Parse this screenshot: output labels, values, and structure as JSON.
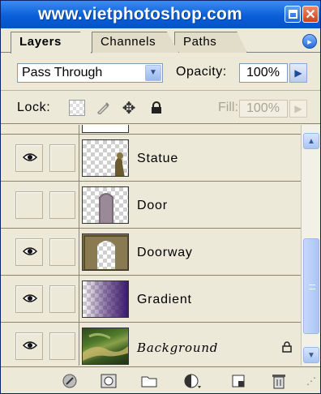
{
  "window": {
    "title": "www.vietphotoshop.com"
  },
  "tabs": [
    {
      "label": "Layers",
      "active": true
    },
    {
      "label": "Channels",
      "active": false
    },
    {
      "label": "Paths",
      "active": false
    }
  ],
  "blend": {
    "mode": "Pass Through",
    "opacity_label": "Opacity:",
    "opacity_value": "100%"
  },
  "lock": {
    "label": "Lock:",
    "fill_label": "Fill:",
    "fill_value": "100%"
  },
  "layers": [
    {
      "name": "Statue",
      "visible": true,
      "thumb": "statue"
    },
    {
      "name": "Door",
      "visible": false,
      "thumb": "door"
    },
    {
      "name": "Doorway",
      "visible": true,
      "thumb": "doorway"
    },
    {
      "name": "Gradient",
      "visible": true,
      "thumb": "gradient"
    },
    {
      "name": "Background",
      "visible": true,
      "thumb": "background",
      "locked": true
    }
  ],
  "icons": {
    "tab_menu": "panel-menu-icon",
    "footer": [
      "link-layers-icon",
      "add-layer-style-icon",
      "add-mask-icon",
      "new-group-icon",
      "new-adjustment-layer-icon",
      "new-layer-icon",
      "delete-layer-icon"
    ]
  }
}
